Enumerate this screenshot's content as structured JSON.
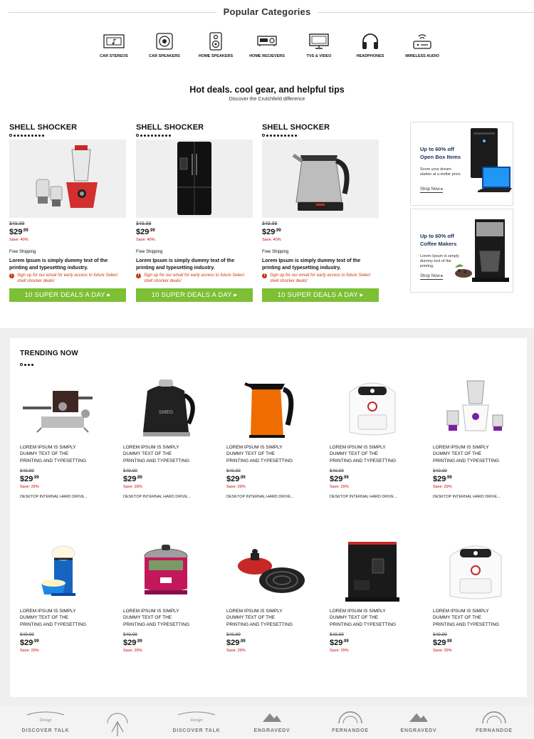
{
  "popular_categories": {
    "title": "Popular Categories",
    "items": [
      {
        "label": "CAR STEREOS",
        "icon": "car-stereo-icon"
      },
      {
        "label": "CAR SPEAKERS",
        "icon": "car-speaker-icon"
      },
      {
        "label": "HOME SPEAKERS",
        "icon": "home-speaker-icon"
      },
      {
        "label": "HOME RECIEVERS",
        "icon": "home-receiver-icon"
      },
      {
        "label": "TVs & VIDEO",
        "icon": "tv-icon"
      },
      {
        "label": "HEADPHONES",
        "icon": "headphones-icon"
      },
      {
        "label": "WIRELESS AUDIO",
        "icon": "wireless-audio-icon"
      }
    ]
  },
  "hot_deals": {
    "title": "Hot deals. cool gear, and helpful tips",
    "subtitle": "Discover the Crutchfield difference",
    "deals": [
      {
        "heading": "SHELL SHOCKER",
        "image": "mixer-grinder",
        "old_price": "$49.99",
        "price": "$29",
        "cents": ".99",
        "save": "Save: 40%",
        "shipping": "Free Shipping",
        "description": "Lorem Ipsum is simply dummy text of the printing and typesetting industry.",
        "note": "Sign up for our email for early access to future Select shell shocker deals!",
        "button": "10 SUPER DEALS A DAY"
      },
      {
        "heading": "SHELL SHOCKER",
        "image": "refrigerator",
        "old_price": "$49.99",
        "price": "$29",
        "cents": ".99",
        "save": "Save: 40%",
        "shipping": "Free Shipping",
        "description": "Lorem Ipsum is simply dummy text of the printing and typesetting industry.",
        "note": "Sign up for our email for early access to future Select shell shocker deals!",
        "button": "10 SUPER DEALS A DAY"
      },
      {
        "heading": "SHELL SHOCKER",
        "image": "electric-kettle",
        "old_price": "$49.99",
        "price": "$29",
        "cents": ".99",
        "save": "Save: 40%",
        "shipping": "Free Shipping",
        "description": "Lorem Ipsum is simply dummy text of the printing and typesetting industry.",
        "note": "Sign up for our email for early access to future Select shell shocker deals!",
        "button": "10 SUPER DEALS A DAY"
      }
    ],
    "promos": [
      {
        "title_line1": "Up to 60% off",
        "title_line2": "Open Box Items",
        "text_line1": "Score your dream",
        "text_line2": "station at a stellar price.",
        "text_line3": "",
        "link": "Shop Now"
      },
      {
        "title_line1": "Up to 60% off",
        "title_line2": "Coffee Makers",
        "text_line1": "Lorem Ipsum is simply",
        "text_line2": "dummy text of the",
        "text_line3": "printing.",
        "link": "Shop Now"
      }
    ]
  },
  "trending": {
    "title": "TRENDING NOW",
    "items": [
      {
        "image": "espresso-machine",
        "name_line1": "LOREM IPSUM IS SIMPLY",
        "name_line2": "DUMMY TEXT OF THE",
        "name_line3": "PRINTING AND TYPESETTING",
        "old_price": "$49.99",
        "price": "$29",
        "cents": ".99",
        "save": "Save:  29%",
        "desc": "DESKTOP INTERNAL HARD DRIVE..."
      },
      {
        "image": "black-kettle",
        "name_line1": "LOREM IPSUM IS SIMPLY",
        "name_line2": "DUMMY TEXT OF THE",
        "name_line3": "PRINTING AND TYPESETTING",
        "old_price": "$49.99",
        "price": "$29",
        "cents": ".99",
        "save": "Save:  29%",
        "desc": "DESKTOP INTERNAL HARD DRIVE..."
      },
      {
        "image": "orange-kettle",
        "name_line1": "LOREM IPSUM IS SIMPLY",
        "name_line2": "DUMMY TEXT OF THE",
        "name_line3": "PRINTING AND TYPESETTING",
        "old_price": "$49.99",
        "price": "$29",
        "cents": ".99",
        "save": "Save:  29%",
        "desc": "DESKTOP INTERNAL HARD DRIVE..."
      },
      {
        "image": "air-fryer",
        "name_line1": "LOREM IPSUM IS SIMPLY",
        "name_line2": "DUMMY TEXT OF THE",
        "name_line3": "PRINTING AND TYPESETTING",
        "old_price": "$49.99",
        "price": "$29",
        "cents": ".99",
        "save": "Save:  29%",
        "desc": "DESKTOP INTERNAL HARD DRIVE..."
      },
      {
        "image": "purple-mixer",
        "name_line1": "LOREM IPSUM IS SIMPLY",
        "name_line2": "DUMMY TEXT OF THE",
        "name_line3": "PRINTING AND TYPESETTING",
        "old_price": "$49.99",
        "price": "$29",
        "cents": ".99",
        "save": "Save:  29%",
        "desc": "DESKTOP INTERNAL HARD DRIVE..."
      },
      {
        "image": "popcorn-maker",
        "name_line1": "LOREM IPSUM IS SIMPLY",
        "name_line2": "DUMMY TEXT OF THE",
        "name_line3": "PRINTING AND TYPESETTING",
        "old_price": "$49.99",
        "price": "$29",
        "cents": ".99",
        "save": "Save:  29%",
        "desc": ""
      },
      {
        "image": "rice-cooker",
        "name_line1": "LOREM IPSUM IS SIMPLY",
        "name_line2": "DUMMY TEXT OF THE",
        "name_line3": "PRINTING AND TYPESETTING",
        "old_price": "$49.99",
        "price": "$29",
        "cents": ".99",
        "save": "Save:  29%",
        "desc": ""
      },
      {
        "image": "induction-cooker",
        "name_line1": "LOREM IPSUM IS SIMPLY",
        "name_line2": "DUMMY TEXT OF THE",
        "name_line3": "PRINTING AND TYPESETTING",
        "old_price": "$49.99",
        "price": "$29",
        "cents": ".99",
        "save": "Save:  29%",
        "desc": ""
      },
      {
        "image": "coffee-grinder",
        "name_line1": "LOREM IPSUM IS SIMPLY",
        "name_line2": "DUMMY TEXT OF THE",
        "name_line3": "PRINTING AND TYPESETTING",
        "old_price": "$49.99",
        "price": "$29",
        "cents": ".99",
        "save": "Save:  29%",
        "desc": ""
      },
      {
        "image": "air-fryer",
        "name_line1": "LOREM IPSUM IS SIMPLY",
        "name_line2": "DUMMY TEXT OF THE",
        "name_line3": "PRINTING AND TYPESETTING",
        "old_price": "$49.99",
        "price": "$29",
        "cents": ".99",
        "save": "Save:  29%",
        "desc": ""
      }
    ]
  },
  "brand_logos": [
    "DISCOVER TALK",
    "",
    "DISCOVER TALK",
    "ENGRAVEDV",
    "FERNANDOE",
    "ENGRAVEDV",
    "FERNANDOE"
  ],
  "colors": {
    "accent_green": "#7dbf35",
    "save_red": "#cc0000",
    "note_orange": "#c8370e",
    "promo_navy": "#1c2f5a"
  }
}
